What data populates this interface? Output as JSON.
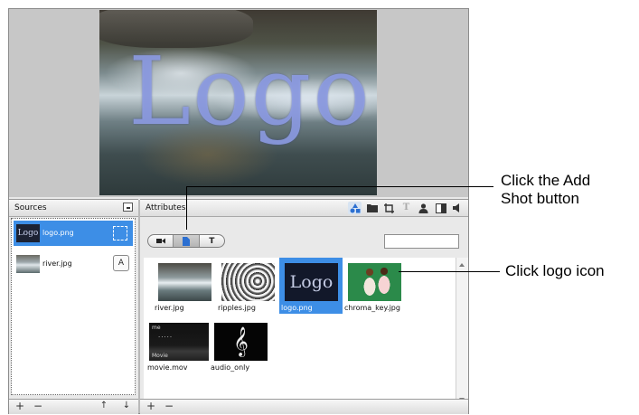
{
  "sources": {
    "header": "Sources",
    "items": [
      {
        "name": "logo.png",
        "selected": true
      },
      {
        "name": "river.jpg",
        "selected": false,
        "button": "A"
      }
    ],
    "bottom_buttons": [
      "+",
      "−",
      "↑",
      "↓"
    ]
  },
  "attributes": {
    "header": "Attributes",
    "segment_tabs": [
      "video",
      "shot",
      "T"
    ],
    "toolbar_icons": [
      "shapes-icon",
      "folder-icon",
      "crop-icon",
      "text-icon",
      "person-icon",
      "split-icon",
      "speaker-icon"
    ],
    "shots": [
      {
        "name": "river.jpg",
        "selected": false
      },
      {
        "name": "ripples.jpg",
        "selected": false
      },
      {
        "name": "logo.png",
        "selected": true,
        "thumb_text": "Logo"
      },
      {
        "name": "chroma_key.jpg",
        "selected": false
      },
      {
        "name": "movie.mov",
        "selected": false,
        "thumb_text": "Movie"
      },
      {
        "name": "audio_only",
        "selected": false
      }
    ],
    "bottom_buttons": [
      "+",
      "−"
    ]
  },
  "preview": {
    "overlay_text": "Logo"
  },
  "callouts": [
    {
      "text_line1": "Click the Add",
      "text_line2": "Shot button"
    },
    {
      "text_line1": "Click logo icon"
    }
  ]
}
